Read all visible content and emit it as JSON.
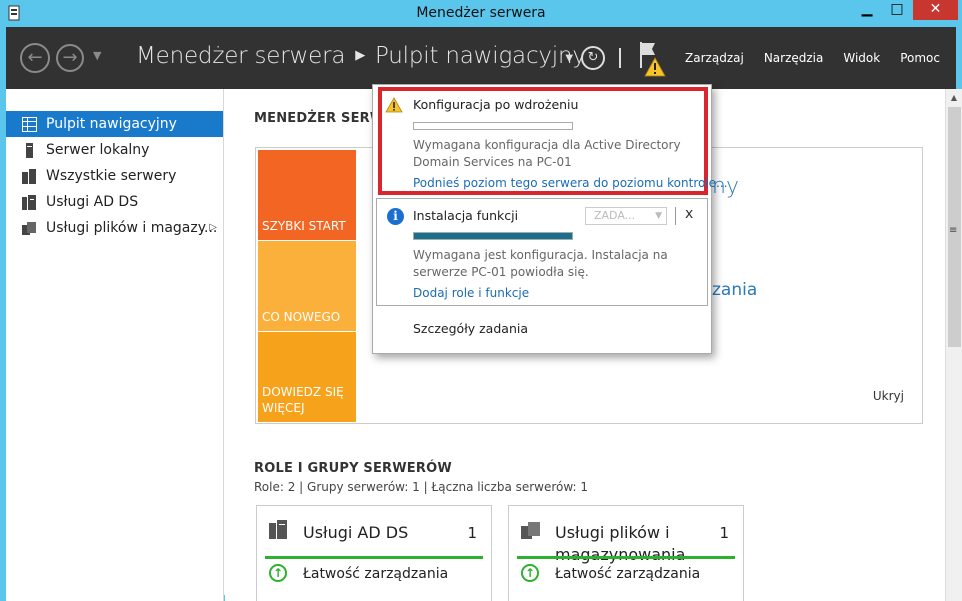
{
  "window": {
    "title": "Menedżer serwera",
    "controls": {
      "minimize": "▁",
      "maximize": "□",
      "close": "✕"
    }
  },
  "toolbar": {
    "back_icon": "back-arrow-icon",
    "forward_icon": "forward-arrow-icon",
    "crumb_root": "Menedżer serwera",
    "crumb_sep": "▶",
    "crumb_page": "Pulpit nawigacyjny",
    "menus": [
      "Zarządzaj",
      "Narzędzia",
      "Widok",
      "Pomoc"
    ]
  },
  "sidebar": {
    "items": [
      {
        "label": "Pulpit nawigacyjny",
        "icon": "dashboard-icon",
        "active": true
      },
      {
        "label": "Serwer lokalny",
        "icon": "server-icon",
        "active": false
      },
      {
        "label": "Wszystkie serwery",
        "icon": "servers-icon",
        "active": false
      },
      {
        "label": "Usługi AD DS",
        "icon": "ad-ds-icon",
        "active": false
      },
      {
        "label": "Usługi plików i magazy...",
        "icon": "file-services-icon",
        "active": false,
        "has_arrow": true
      }
    ]
  },
  "main": {
    "welcome_title": "MENEDŻER SERW",
    "tiles": [
      "SZYBKI START",
      "CO NOWEGO",
      "DOWIEDZ SIĘ WIĘCEJ"
    ],
    "bg_text1": "ny",
    "bg_text2": "zania",
    "hide_link": "Ukryj",
    "roles_title": "ROLE I GRUPY SERWERÓW",
    "roles_subtitle": "Role: 2 | Grupy serwerów: 1 | Łączna liczba serwerów: 1",
    "cards": [
      {
        "title": "Usługi AD DS",
        "count": "1",
        "mgmt": "Łatwość zarządzania"
      },
      {
        "title": "Usługi plików i magazynowania",
        "count": "1",
        "mgmt": "Łatwość zarządzania"
      }
    ]
  },
  "notifications": {
    "task1": {
      "title": "Konfiguracja po wdrożeniu",
      "description": "Wymagana konfiguracja dla Active Directory Domain Services na PC-01",
      "link": "Podnieś poziom tego serwera do poziomu kontrole...",
      "progress": 0
    },
    "task2": {
      "title": "Instalacja funkcji",
      "dropdown": "ZADA...",
      "close": "x",
      "description": "Wymagana jest konfiguracja. Instalacja na serwerze PC-01 powiodła się.",
      "link": "Dodaj role i funkcje",
      "progress": 1
    },
    "details_link": "Szczegóły zadania"
  },
  "colors": {
    "titlebar": "#5ac6ec",
    "toolbar": "#323232",
    "accent": "#1979ca",
    "tile_quick_start": "#f26522",
    "tile_whats_new": "#fbb03b",
    "tile_learn_more": "#f7a21b",
    "highlight": "#d9252e",
    "progress_fill": "#1a6f8a",
    "health_ok": "#2eb12e"
  }
}
